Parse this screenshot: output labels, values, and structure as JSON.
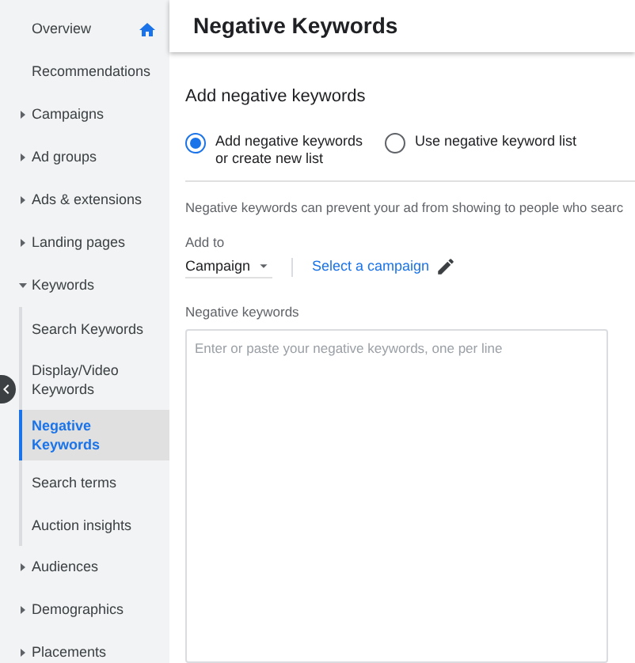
{
  "sidebar": {
    "items": [
      {
        "label": "Overview",
        "kind": "home"
      },
      {
        "label": "Recommendations",
        "kind": "link"
      },
      {
        "label": "Campaigns",
        "kind": "group",
        "expanded": false
      },
      {
        "label": "Ad groups",
        "kind": "group",
        "expanded": false
      },
      {
        "label": "Ads & extensions",
        "kind": "group",
        "expanded": false
      },
      {
        "label": "Landing pages",
        "kind": "group",
        "expanded": false
      },
      {
        "label": "Keywords",
        "kind": "group",
        "expanded": true,
        "children": [
          {
            "label": "Search Keywords",
            "selected": false
          },
          {
            "label": "Display/Video Keywords",
            "selected": false
          },
          {
            "label": "Negative Keywords",
            "selected": true
          },
          {
            "label": "Search terms",
            "selected": false
          },
          {
            "label": "Auction insights",
            "selected": false
          }
        ]
      },
      {
        "label": "Audiences",
        "kind": "group",
        "expanded": false
      },
      {
        "label": "Demographics",
        "kind": "group",
        "expanded": false
      },
      {
        "label": "Placements",
        "kind": "group",
        "expanded": false
      }
    ]
  },
  "page_title": "Negative Keywords",
  "form": {
    "section_title": "Add negative keywords",
    "options": [
      {
        "label": "Add negative keywords or create new list",
        "selected": true
      },
      {
        "label": "Use negative keyword list",
        "selected": false
      }
    ],
    "description": "Negative keywords can prevent your ad from showing to people who searc",
    "add_to": {
      "label": "Add to",
      "value": "Campaign"
    },
    "campaign_link": "Select a campaign",
    "keywords_field": {
      "label": "Negative keywords",
      "placeholder": "Enter or paste your negative keywords, one per line"
    }
  }
}
